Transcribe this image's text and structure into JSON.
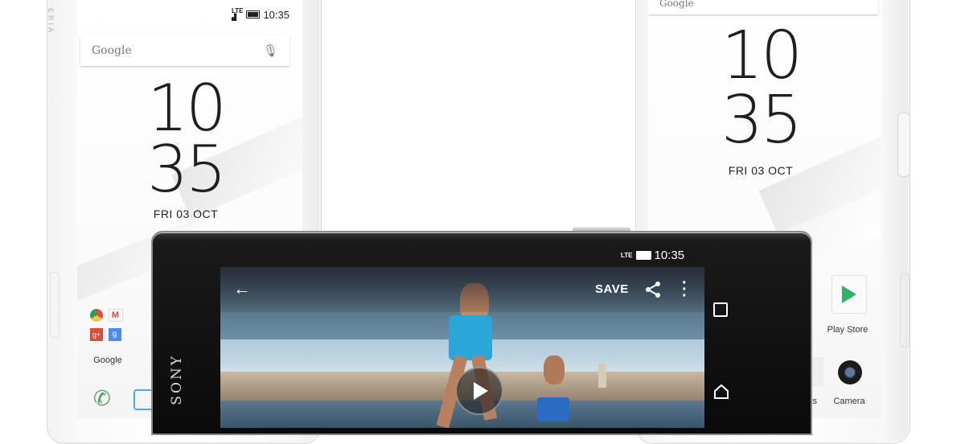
{
  "left_phone": {
    "brand_vertical": "ERIA",
    "status_time": "10:35",
    "search_logo": "Google",
    "clock_hour": "10",
    "clock_minute": "35",
    "date": "FRI 03 OCT",
    "folder_label": "Google",
    "icons": [
      "chrome-icon",
      "gmail-icon",
      "google-plus-icon",
      "google-apps-icon",
      "phone-icon"
    ]
  },
  "right_phone": {
    "search_logo": "Google",
    "clock_hour": "10",
    "clock_minute": "35",
    "date": "FRI 03 OCT",
    "play_store_label": "Play Store",
    "camera_label": "Camera",
    "contacts_label": "cts"
  },
  "center_phone": {
    "brand": "SONY",
    "status_time": "10:35",
    "status_network": "LTE",
    "toolbar": {
      "back_icon": "arrow-left-icon",
      "save_label": "SAVE",
      "share_icon": "share-icon",
      "more_icon": "more-vert-icon"
    },
    "nav": {
      "recents_icon": "square-icon",
      "home_icon": "home-icon"
    },
    "play_icon": "play-icon"
  },
  "colors": {
    "phone_white": "#ffffff",
    "phone_black": "#0a0a0a",
    "sky": "#9dbdd2",
    "shorts_blue": "#2aa6d8"
  }
}
